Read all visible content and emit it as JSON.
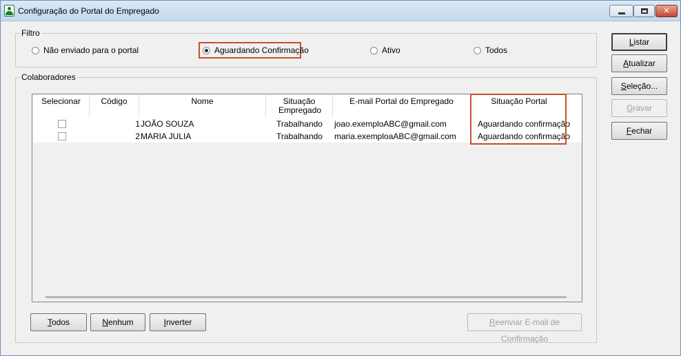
{
  "window": {
    "title": "Configuração do Portal do Empregado",
    "controls": {
      "minimize": "",
      "maximize": "",
      "close": "✕"
    }
  },
  "filter": {
    "label": "Filtro",
    "options": [
      {
        "label": "Não enviado para o portal",
        "checked": false
      },
      {
        "label": "Aguardando Confirmação",
        "checked": true
      },
      {
        "label": "Ativo",
        "checked": false
      },
      {
        "label": "Todos",
        "checked": false
      }
    ]
  },
  "collaborators": {
    "label": "Colaboradores",
    "columns": [
      "Selecionar",
      "Código",
      "Nome",
      "Situação Empregado",
      "E-mail Portal do Empregado",
      "Situação Portal"
    ],
    "rows": [
      {
        "selected": false,
        "codigo": "1",
        "nome": "JOÃO SOUZA",
        "situacao": "Trabalhando",
        "email": "joao.exemploABC@gmail.com",
        "portal": "Aguardando confirmação"
      },
      {
        "selected": false,
        "codigo": "2",
        "nome": "MARIA JULIA",
        "situacao": "Trabalhando",
        "email": "maria.exemploaABC@gmail.com",
        "portal": "Aguardando confirmação"
      }
    ]
  },
  "bottom_buttons": {
    "todos": {
      "u": "T",
      "rest": "odos"
    },
    "nenhum": {
      "u": "N",
      "rest": "enhum"
    },
    "inverter": {
      "u": "I",
      "rest": "nverter"
    },
    "reenviar": {
      "u": "R",
      "rest": "eenviar E-mail de Confirmação",
      "disabled": true
    }
  },
  "side_buttons": {
    "listar": {
      "u": "L",
      "rest": "istar"
    },
    "atualizar": {
      "u": "A",
      "rest": "tualizar"
    },
    "selecao": {
      "u": "S",
      "rest": "eleção..."
    },
    "gravar": {
      "u": "G",
      "rest": "ravar",
      "disabled": true
    },
    "fechar": {
      "u": "F",
      "rest": "echar"
    }
  }
}
